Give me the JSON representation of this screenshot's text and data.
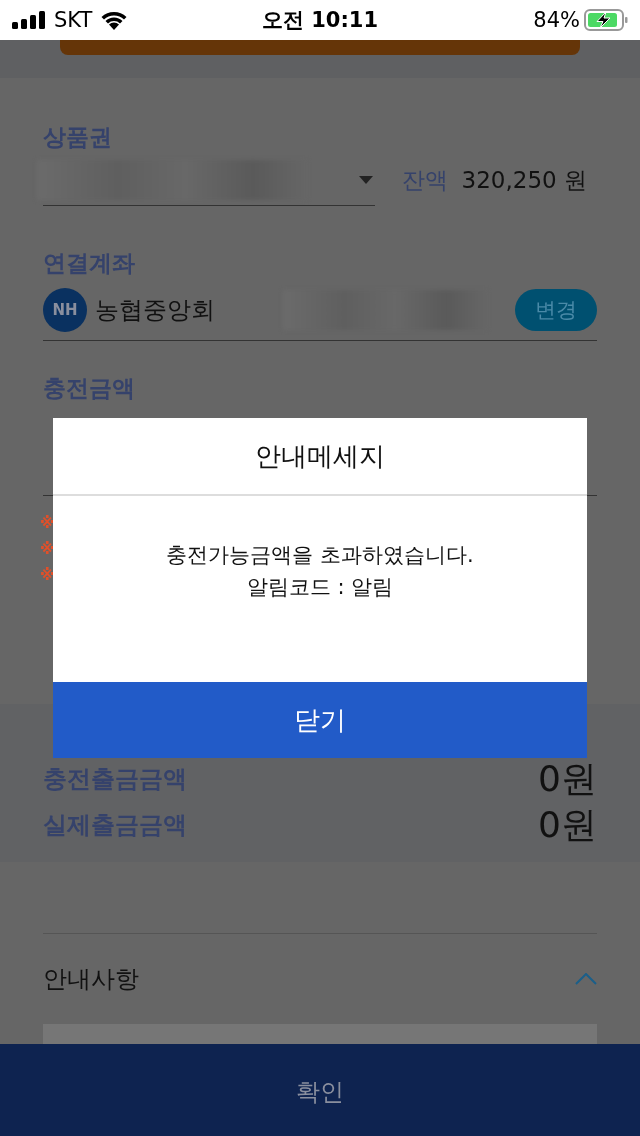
{
  "status_bar": {
    "carrier": "SKT",
    "time": "오전 10:11",
    "battery": "84%"
  },
  "form": {
    "voucher_label": "상품권",
    "balance_label": "잔액",
    "balance": "320,250 원",
    "account_label": "연결계좌",
    "bank": "농협중앙회",
    "bank_logo": "NH",
    "change_button": "변경",
    "amount_label": "충전금액",
    "notes": [
      "※",
      "※",
      "※"
    ]
  },
  "summary": [
    {
      "label": "충전출금금액",
      "value": "0원"
    },
    {
      "label": "실제출금금액",
      "value": "0원"
    }
  ],
  "notice": {
    "title": "안내사항",
    "expanded": true
  },
  "confirm_button": "확인",
  "dialog": {
    "title": "안내메세지",
    "message": [
      "충전가능금액을 초과하였습니다.",
      "알림코드 : 알림"
    ],
    "close_button": "닫기"
  }
}
